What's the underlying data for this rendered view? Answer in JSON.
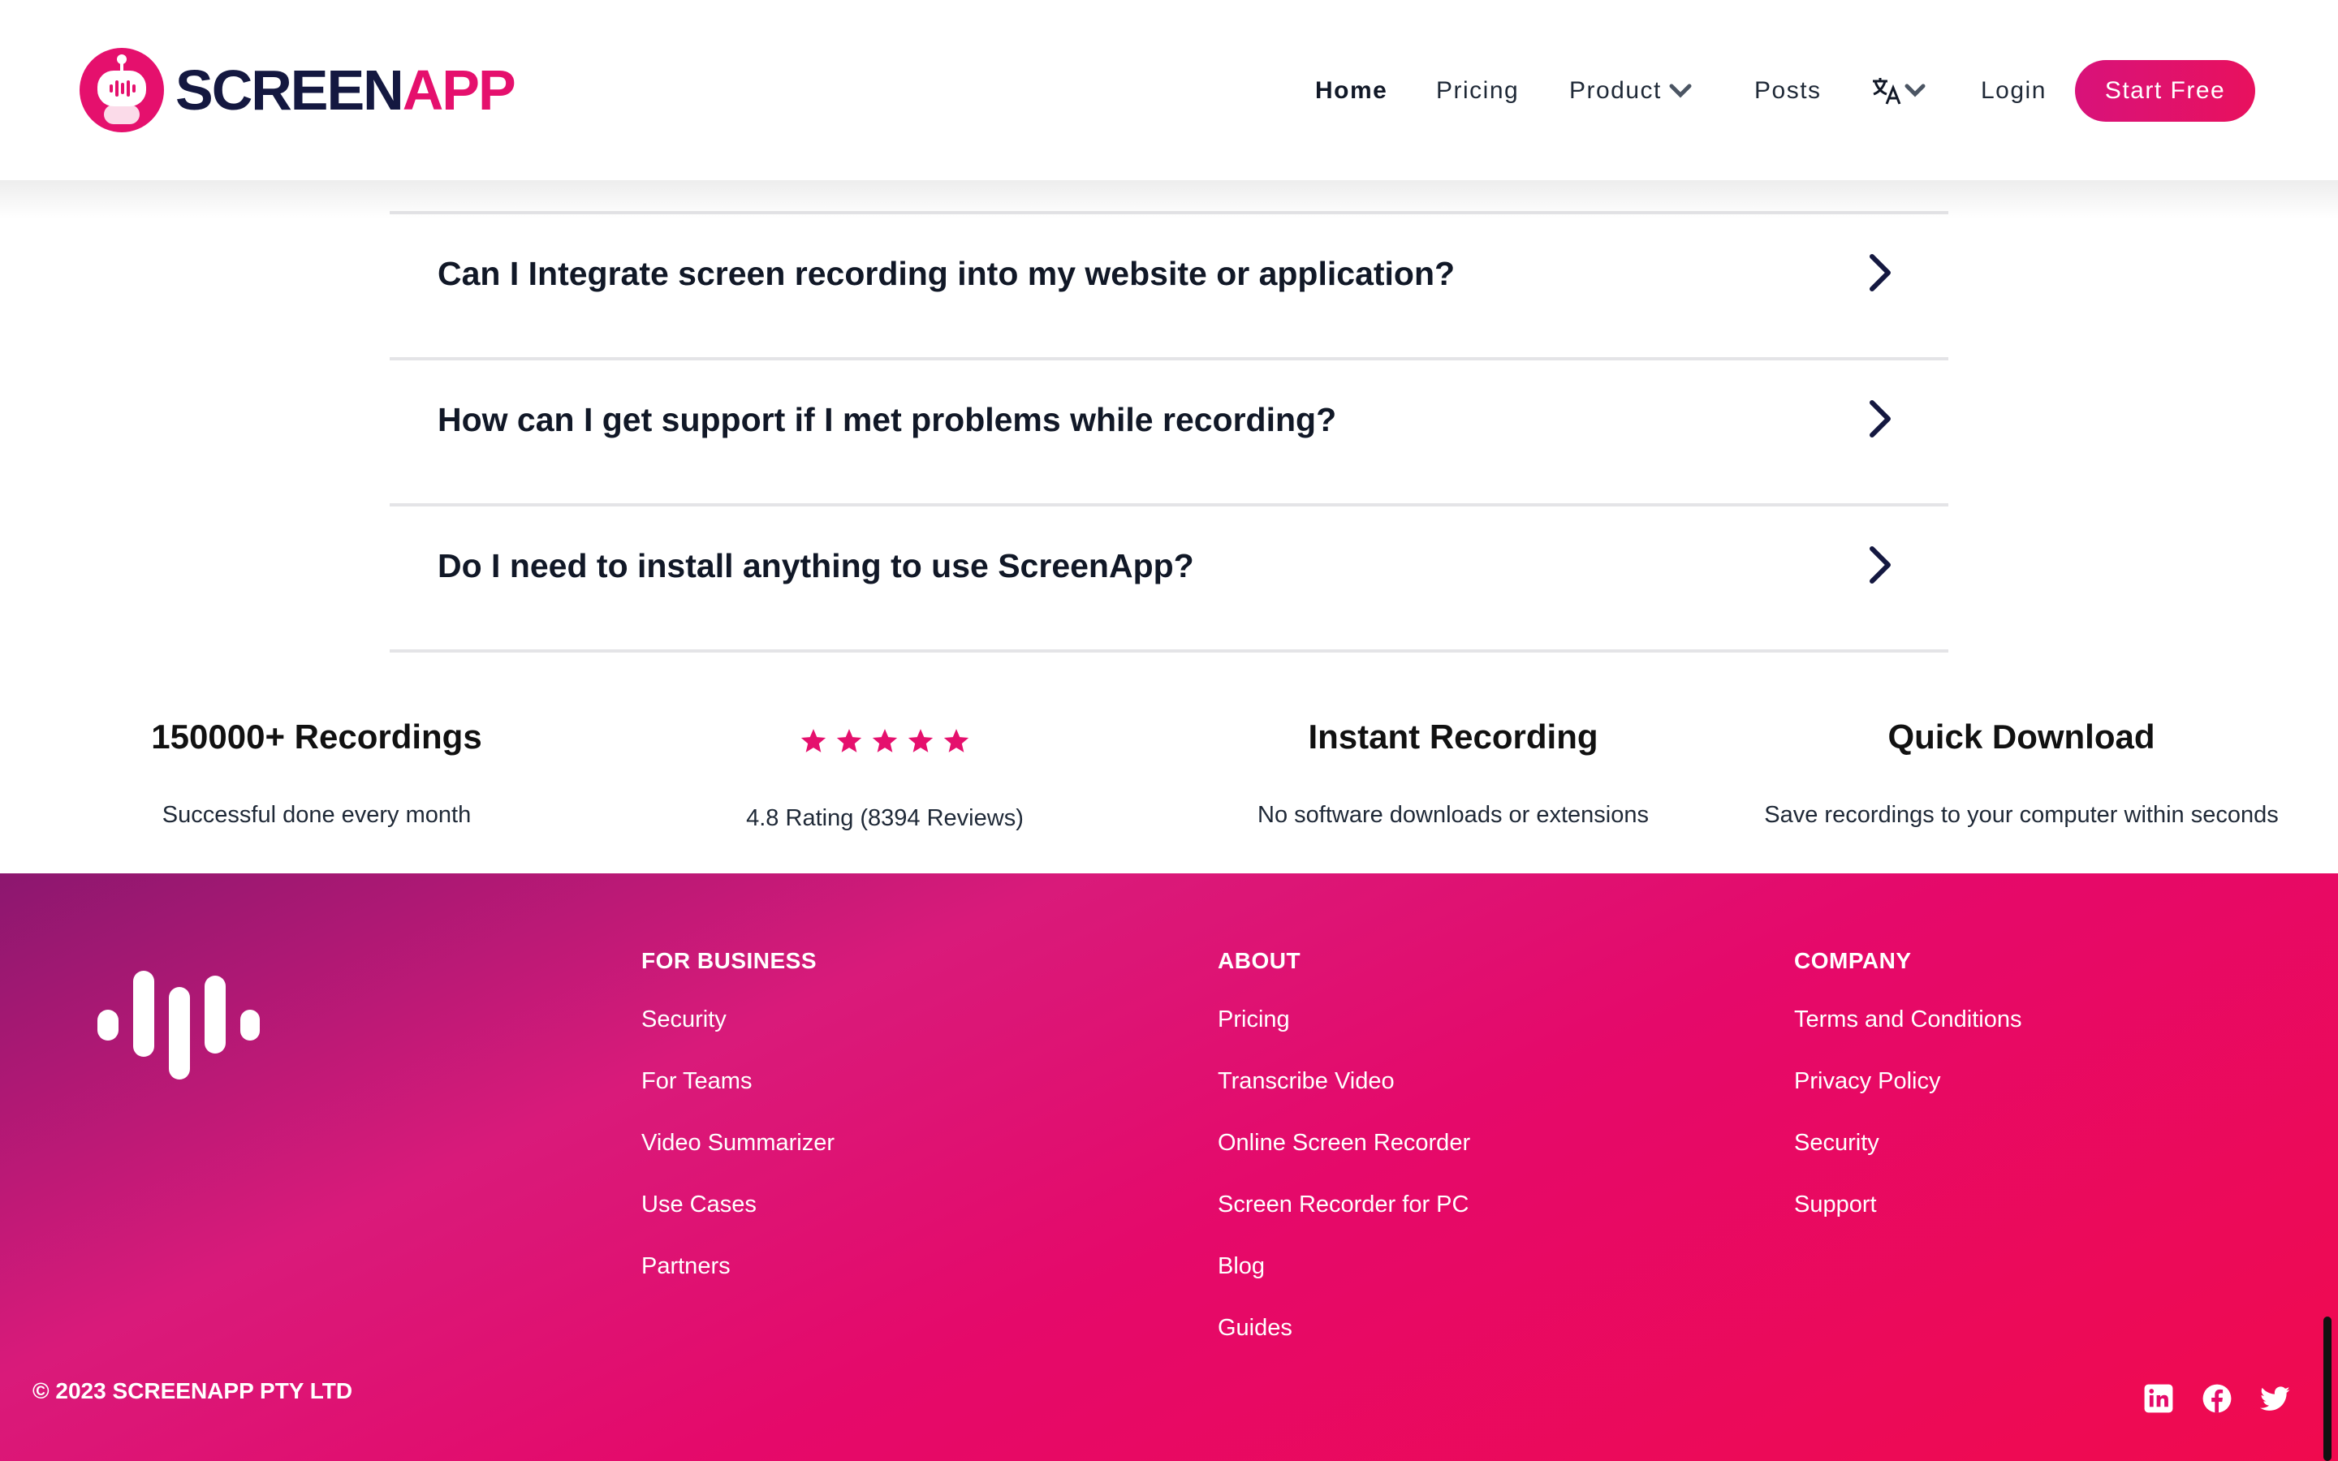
{
  "brand": {
    "name_part1": "SCREEN",
    "name_part2": "APP",
    "accent": "#e5106d",
    "dark": "#141840"
  },
  "nav": {
    "home": "Home",
    "pricing": "Pricing",
    "product": "Product",
    "posts": "Posts",
    "language_icon": "translate-icon",
    "login": "Login",
    "start_free": "Start Free"
  },
  "faq": {
    "items": [
      {
        "question": "Can I Integrate screen recording into my website or application?"
      },
      {
        "question": "How can I get support if I met problems while recording?"
      },
      {
        "question": "Do I need to install anything to use ScreenApp?"
      }
    ]
  },
  "stats": [
    {
      "title": "150000+ Recordings",
      "subtitle": "Successful done every month"
    },
    {
      "rating_stars": 5,
      "subtitle": "4.8 Rating (8394 Reviews)"
    },
    {
      "title": "Instant Recording",
      "subtitle": "No software downloads or extensions"
    },
    {
      "title": "Quick Download",
      "subtitle": "Save recordings to your computer within seconds"
    }
  ],
  "footer": {
    "columns": [
      {
        "heading": "FOR BUSINESS",
        "links": [
          "Security",
          "For Teams",
          "Video Summarizer",
          "Use Cases",
          "Partners"
        ]
      },
      {
        "heading": "ABOUT",
        "links": [
          "Pricing",
          "Transcribe Video",
          "Online Screen Recorder",
          "Screen Recorder for PC",
          "Blog",
          "Guides"
        ]
      },
      {
        "heading": "COMPANY",
        "links": [
          "Terms and Conditions",
          "Privacy Policy",
          "Security",
          "Support"
        ]
      }
    ],
    "copyright": "© 2023 SCREENAPP PTY LTD",
    "social": [
      "linkedin-icon",
      "facebook-icon",
      "twitter-icon"
    ],
    "gradient_start": "#8c176f",
    "gradient_end": "#f00a4e"
  }
}
